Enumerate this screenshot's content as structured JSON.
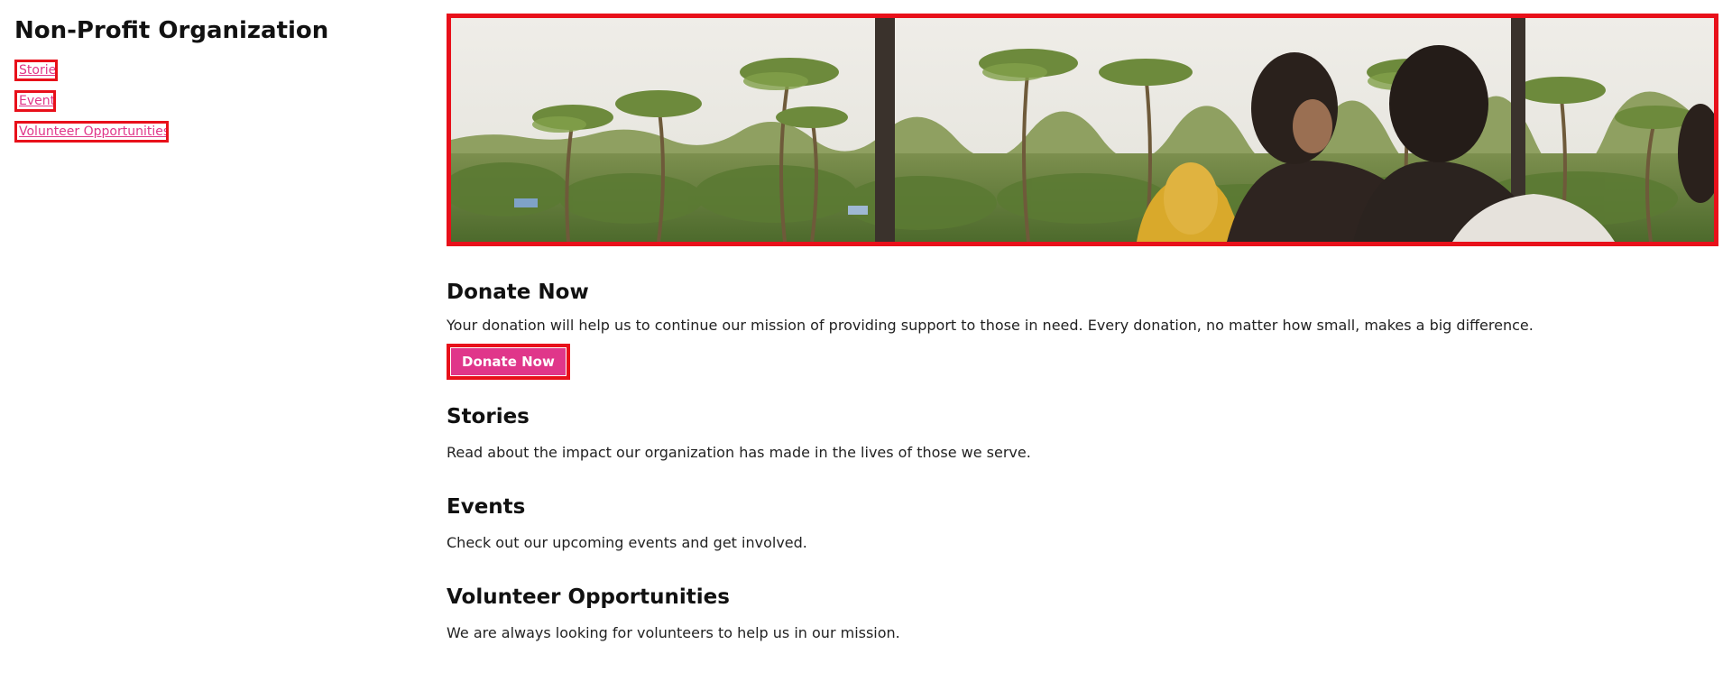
{
  "site": {
    "title": "Non-Profit Organization"
  },
  "nav": {
    "items": [
      {
        "label": "Stories"
      },
      {
        "label": "Events"
      },
      {
        "label": "Volunteer Opportunities"
      }
    ]
  },
  "hero": {
    "image": "banner-photo-palm-trees-people"
  },
  "donate": {
    "heading": "Donate Now",
    "text": "Your donation will help us to continue our mission of providing support to those in need. Every donation, no matter how small, makes a big difference.",
    "button_label": "Donate Now"
  },
  "stories": {
    "heading": "Stories",
    "text": "Read about the impact our organization has made in the lives of those we serve."
  },
  "events": {
    "heading": "Events",
    "text": "Check out our upcoming events and get involved."
  },
  "volunteer": {
    "heading": "Volunteer Opportunities",
    "text": "We are always looking for volunteers to help us in our mission."
  },
  "colors": {
    "accent": "#e0368a",
    "outline": "#e8101a"
  }
}
